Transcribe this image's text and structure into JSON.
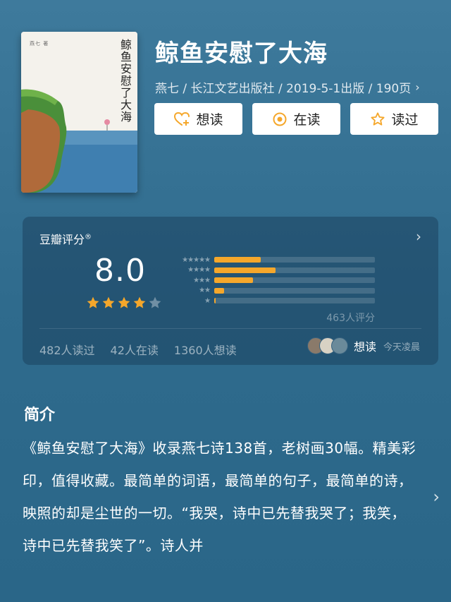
{
  "book": {
    "title": "鲸鱼安慰了大海",
    "meta": "燕七 / 长江文艺出版社 / 2019-5-1出版 / 190页",
    "cover_title": "鲸鱼安慰了大海",
    "cover_small": "燕七 著"
  },
  "actions": [
    {
      "label": "想读",
      "icon": "heart-plus-icon"
    },
    {
      "label": "在读",
      "icon": "target-circle-icon"
    },
    {
      "label": "读过",
      "icon": "star-outline-icon"
    }
  ],
  "rating": {
    "label": "豆瓣评分",
    "label_sup": "®",
    "score": "8.0",
    "stars": 4,
    "distribution": [
      {
        "stars": 5,
        "fraction": 0.29
      },
      {
        "stars": 4,
        "fraction": 0.38
      },
      {
        "stars": 3,
        "fraction": 0.24
      },
      {
        "stars": 2,
        "fraction": 0.06
      },
      {
        "stars": 1,
        "fraction": 0.01
      }
    ],
    "votes": "463人评分",
    "counts": [
      "482人读过",
      "42人在读",
      "1360人想读"
    ],
    "friends_action": "想读",
    "friends_time": "今天凌晨"
  },
  "intro": {
    "heading": "简介",
    "text": "《鲸鱼安慰了大海》收录燕七诗138首，老树画30幅。精美彩印，值得收藏。最简单的词语，最简单的句子，最简单的诗，映照的却是尘世的一切。“我哭，诗中已先替我哭了；我笑，诗中已先替我笑了”。诗人并"
  },
  "colors": {
    "background": "#2f6b8d",
    "accent": "#f5a72b",
    "card": "#1c425e"
  }
}
